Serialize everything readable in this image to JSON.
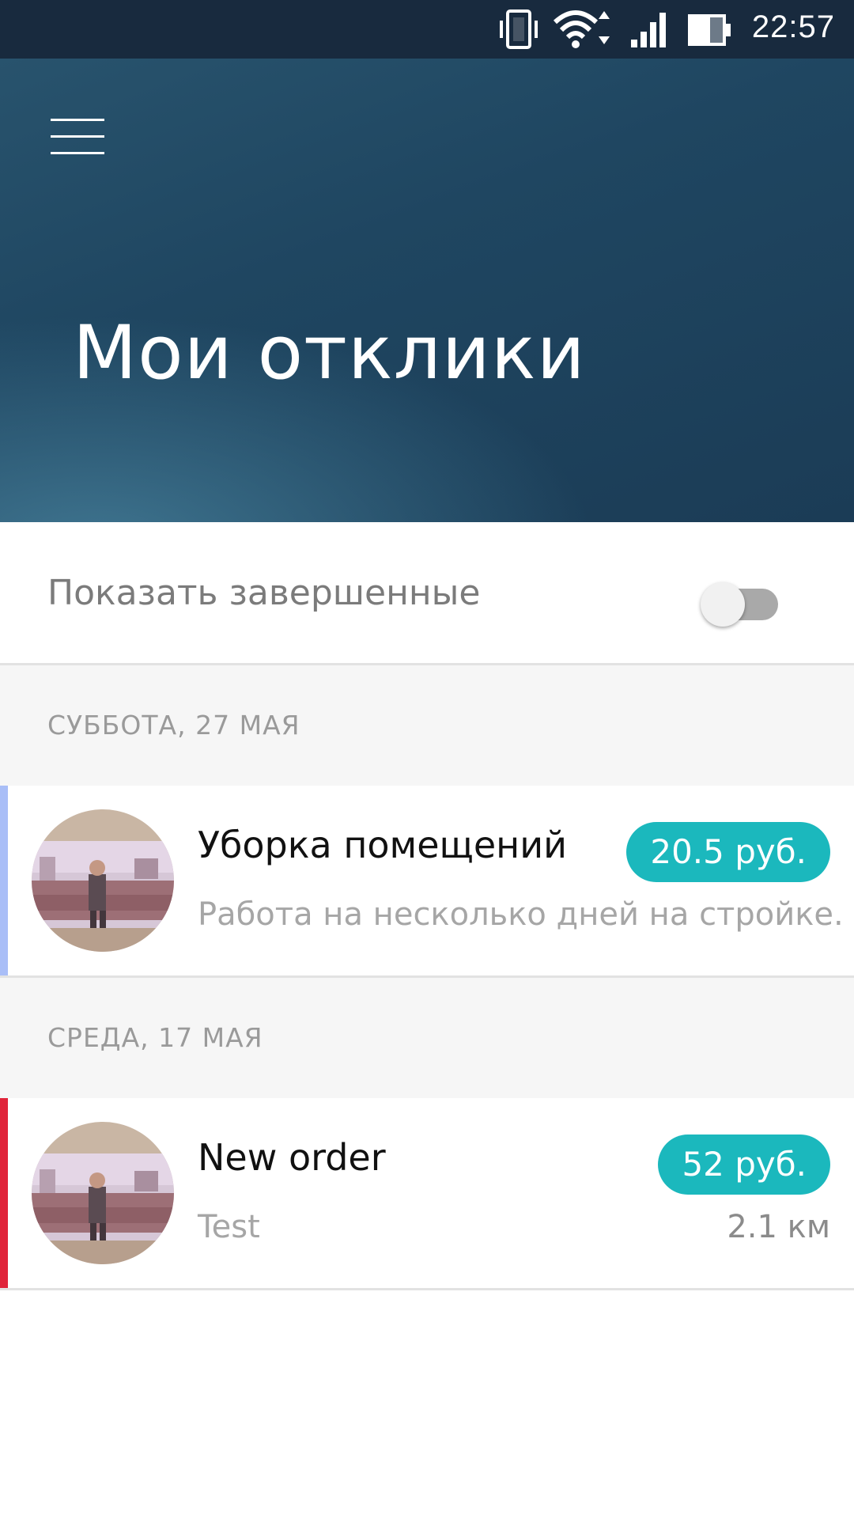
{
  "status_bar": {
    "time": "22:57",
    "icons": [
      "vibrate-icon",
      "wifi-icon",
      "signal-icon",
      "battery-icon"
    ]
  },
  "header": {
    "menu_icon": "hamburger-menu-icon",
    "title": "Мои отклики"
  },
  "filter": {
    "label": "Показать завершенные",
    "enabled": false
  },
  "sections": [
    {
      "date": "СУББОТА, 27 МАЯ",
      "items": [
        {
          "title": "Уборка помещений",
          "subtitle": "Работа на несколько дней на стройке.",
          "price": "20.5 руб.",
          "distance": "",
          "accent_color": "#a9bef7"
        }
      ]
    },
    {
      "date": "СРЕДА, 17 МАЯ",
      "items": [
        {
          "title": "New order",
          "subtitle": "Test",
          "price": "52 руб.",
          "distance": "2.1 км",
          "accent_color": "#e0243a"
        }
      ]
    }
  ],
  "colors": {
    "header_dark": "#1b3c56",
    "badge": "#1bb8bd"
  }
}
